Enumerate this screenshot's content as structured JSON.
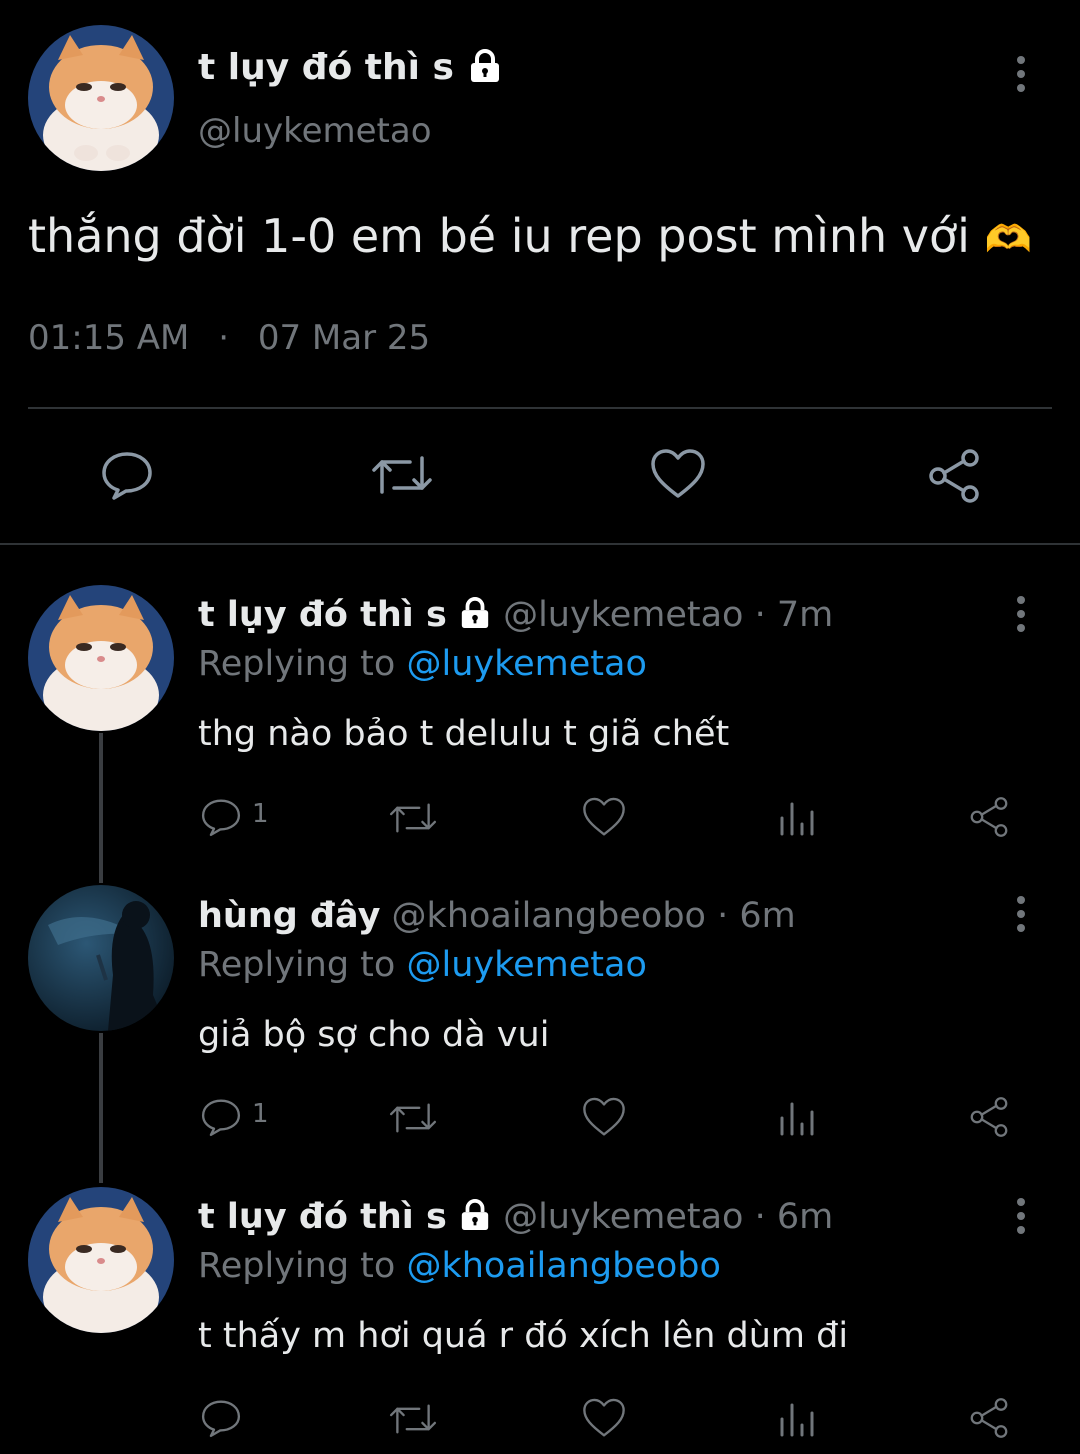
{
  "main_tweet": {
    "display_name": "t lụy đó thì s",
    "handle": "@luykemetao",
    "text": "thắng đời 1-0 em bé iu rep post mình với",
    "emoji": "🫶",
    "time": "01:15 AM",
    "separator": "·",
    "date": "07 Mar 25",
    "avatar": "cat-avatar"
  },
  "replies": [
    {
      "display_name": "t lụy đó thì s",
      "handle": "@luykemetao",
      "age": "· 7m",
      "replying_prefix": "Replying to",
      "replying_to": "@luykemetao",
      "text": "thg nào bảo t delulu t giã chết",
      "reply_count": "1",
      "locked": true,
      "avatar": "cat-avatar"
    },
    {
      "display_name": "hùng đây",
      "handle": "@khoailangbeobo",
      "age": "· 6m",
      "replying_prefix": "Replying to",
      "replying_to": "@luykemetao",
      "text": "giả bộ sợ cho dà vui",
      "reply_count": "1",
      "locked": false,
      "avatar": "aquarium-avatar"
    },
    {
      "display_name": "t lụy đó thì s",
      "handle": "@luykemetao",
      "age": "· 6m",
      "replying_prefix": "Replying to",
      "replying_to": "@khoailangbeobo",
      "text": "t thấy m hơi quá r đó xích lên dùm đi",
      "reply_count": "",
      "locked": true,
      "avatar": "cat-avatar"
    }
  ],
  "colors": {
    "background": "#000000",
    "text": "#e7e9ea",
    "muted": "#71767b",
    "link": "#1d9bf0",
    "divider": "#2f3336"
  },
  "icons": [
    "reply-icon",
    "retweet-icon",
    "like-icon",
    "views-icon",
    "share-icon",
    "lock-icon",
    "more-icon"
  ]
}
